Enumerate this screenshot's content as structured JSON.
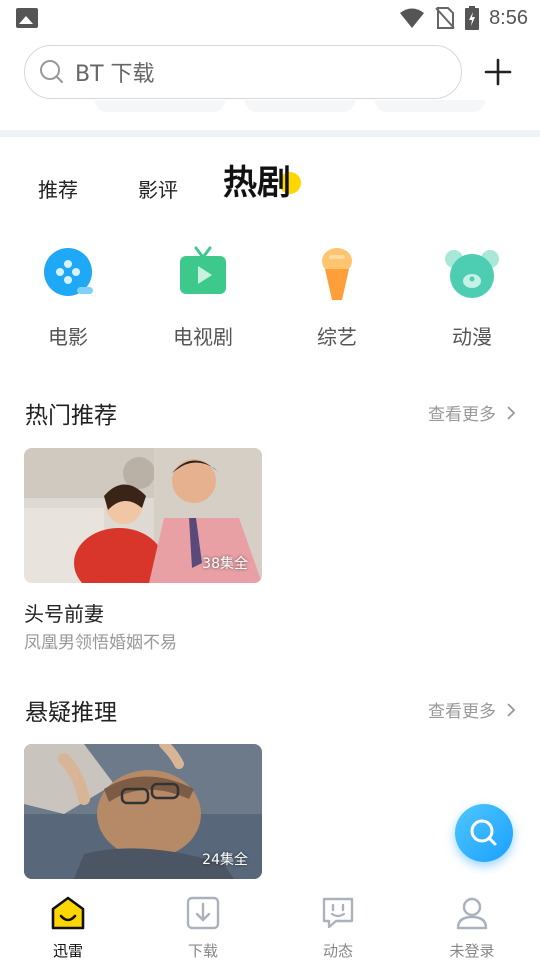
{
  "status_bar": {
    "time": "8:56",
    "icons": [
      "image-icon",
      "wifi-icon",
      "no-sim-icon",
      "battery-charging-icon"
    ]
  },
  "search": {
    "placeholder": "BT 下载",
    "icon": "search-icon",
    "add_icon": "plus-icon"
  },
  "tabs": [
    {
      "label": "推荐",
      "active": false
    },
    {
      "label": "影评",
      "active": false
    },
    {
      "label": "热剧",
      "active": true
    }
  ],
  "categories": [
    {
      "label": "电影",
      "icon": "film-icon",
      "color": "#1ea8f5"
    },
    {
      "label": "电视剧",
      "icon": "tv-play-icon",
      "color": "#3cc98b"
    },
    {
      "label": "综艺",
      "icon": "microphone-icon",
      "color": "#ffab4a"
    },
    {
      "label": "动漫",
      "icon": "cartoon-bear-icon",
      "color": "#4dcdb2"
    }
  ],
  "sections": [
    {
      "title": "热门推荐",
      "more": "查看更多",
      "items": [
        {
          "badge": "38集全",
          "title": "头号前妻",
          "subtitle": "凤凰男领悟婚姻不易"
        }
      ]
    },
    {
      "title": "悬疑推理",
      "more": "查看更多",
      "items": [
        {
          "badge": "24集全"
        }
      ]
    }
  ],
  "fab": {
    "icon": "search-icon",
    "color": "#1aa0ff"
  },
  "bottom_nav": [
    {
      "label": "迅雷",
      "icon": "thunder-home-icon",
      "active": true
    },
    {
      "label": "下载",
      "icon": "download-icon",
      "active": false
    },
    {
      "label": "动态",
      "icon": "chat-icon",
      "active": false
    },
    {
      "label": "未登录",
      "icon": "user-icon",
      "active": false
    }
  ],
  "colors": {
    "accent": "#ffd600",
    "brand_blue": "#1aa0ff"
  }
}
